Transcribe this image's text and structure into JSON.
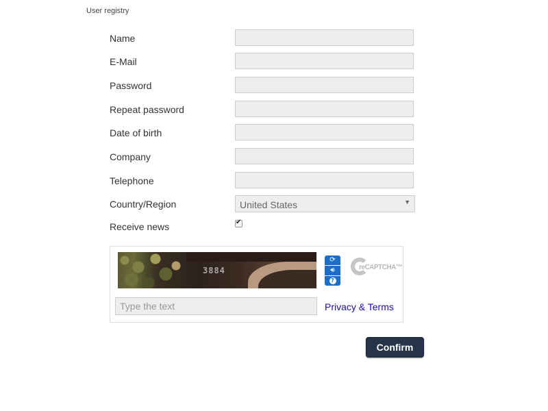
{
  "section": {
    "title": "User registry"
  },
  "fields": [
    {
      "label": "Name",
      "value": ""
    },
    {
      "label": "E-Mail",
      "value": ""
    },
    {
      "label": "Password",
      "value": ""
    },
    {
      "label": "Repeat password",
      "value": ""
    },
    {
      "label": "Date of birth",
      "value": ""
    },
    {
      "label": "Company",
      "value": ""
    },
    {
      "label": "Telephone",
      "value": ""
    }
  ],
  "country": {
    "label": "Country/Region",
    "selected": "United States"
  },
  "news": {
    "label": "Receive news",
    "checked": true
  },
  "captcha": {
    "image_text": "3884",
    "input_placeholder": "Type the text",
    "input_value": "",
    "privacy_label": "Privacy & Terms",
    "logo_text": "reCAPTCHA™",
    "icons": [
      "refresh-icon",
      "audio-icon",
      "help-icon"
    ]
  },
  "actions": {
    "confirm_label": "Confirm"
  },
  "colors": {
    "confirm_bg": "#253446",
    "captcha_tool_bg": "#1b6fc6",
    "link": "#1a0dab",
    "field_bg": "#eeeeee"
  }
}
